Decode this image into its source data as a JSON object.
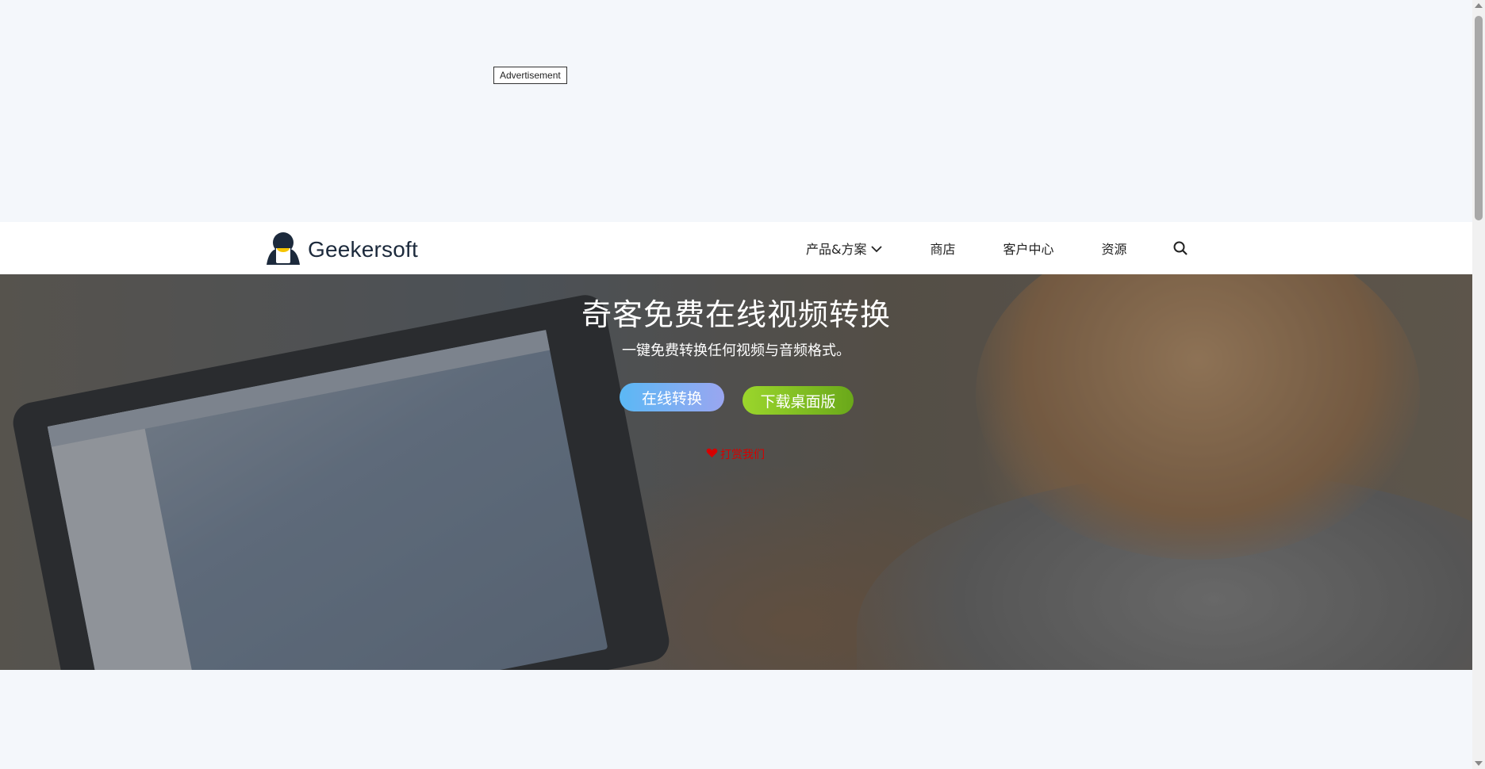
{
  "ad": {
    "label": "Advertisement"
  },
  "header": {
    "brand": "Geekersoft",
    "nav": [
      {
        "label": "产品&方案",
        "has_dropdown": true
      },
      {
        "label": "商店"
      },
      {
        "label": "客户中心"
      },
      {
        "label": "资源"
      }
    ],
    "search_icon": "search-icon"
  },
  "hero": {
    "title": "奇客免费在线视频转换",
    "subtitle": "一键免费转换任何视频与音频格式。",
    "online_button": "在线转换",
    "download_button": "下载桌面版",
    "tip_link": "打赏我们",
    "colors": {
      "online_start": "#5bb8f5",
      "online_end": "#9aa6f0",
      "download_start": "#9bd62c",
      "download_end": "#6aa81a",
      "tip": "#d60000"
    }
  }
}
